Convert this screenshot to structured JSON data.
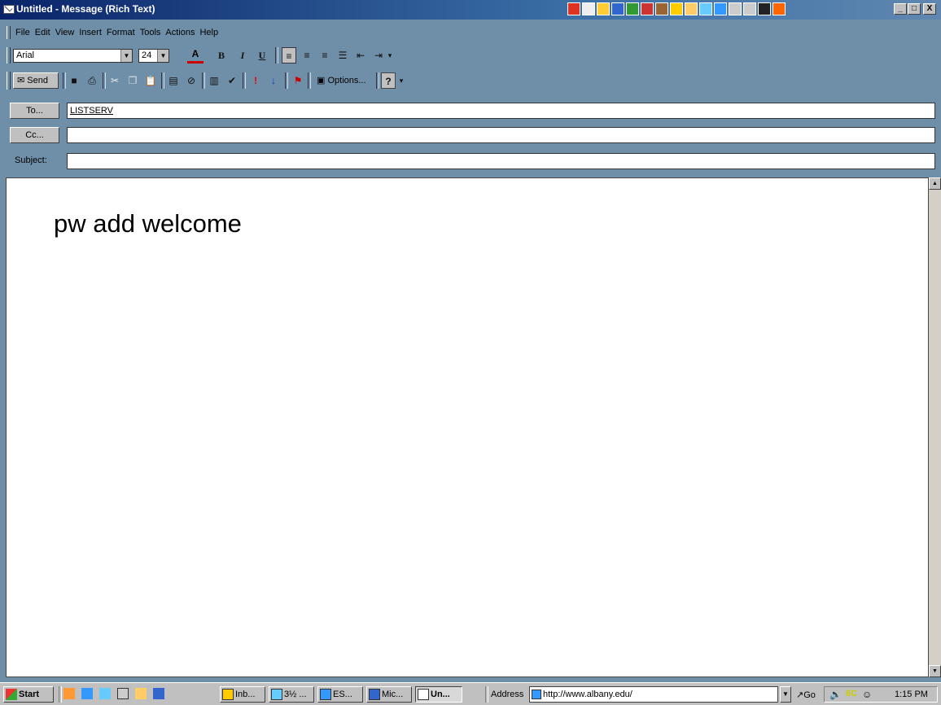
{
  "window": {
    "title": "Untitled - Message (Rich Text)",
    "min_label": "_",
    "max_label": "□",
    "close_label": "X"
  },
  "menu": [
    "File",
    "Edit",
    "View",
    "Insert",
    "Format",
    "Tools",
    "Actions",
    "Help"
  ],
  "format_bar": {
    "font": "Arial",
    "size": "24",
    "color_label": "A",
    "bold": "B",
    "italic": "I",
    "underline": "U"
  },
  "standard_bar": {
    "send": "Send",
    "options": "Options...",
    "flag": "!",
    "low": "↓"
  },
  "fields": {
    "to_label": "To...",
    "to_value": "LISTSERV",
    "cc_label": "Cc...",
    "cc_value": "",
    "subject_label": "Subject:",
    "subject_value": ""
  },
  "body": {
    "text": "pw add welcome"
  },
  "taskbar": {
    "start": "Start",
    "tasks": [
      "Inb...",
      "3½ ...",
      "ES...",
      "Mic...",
      "Un..."
    ],
    "address_label": "Address",
    "address_value": "http://www.albany.edu/",
    "go": "Go",
    "clock": "1:15 PM"
  },
  "colors": {
    "window_bg": "#6f8fa8",
    "titlebar": "#0a246a",
    "font_color_red": "#cc0000"
  }
}
